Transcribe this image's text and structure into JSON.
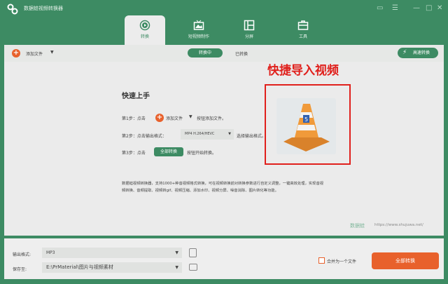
{
  "app": {
    "title": "数据蛙视频转换器"
  },
  "tabs": [
    {
      "label": "转换",
      "icon": "convert-icon",
      "active": true
    },
    {
      "label": "短视频制作",
      "icon": "tv-icon"
    },
    {
      "label": "分屏",
      "icon": "split-screen-icon"
    },
    {
      "label": "工具",
      "icon": "toolbox-icon"
    }
  ],
  "toolbar": {
    "add_file": "添加文件",
    "converting": "转换中",
    "converted": "已转换",
    "fast_convert": "高速转换"
  },
  "guide": {
    "title": "快速上手",
    "step1_prefix": "第1步：点击",
    "step1_button": "添加文件",
    "step1_suffix": "按钮添加文件。",
    "step2_prefix": "第2步：点击输出格式：",
    "step2_format": "MP4 H.264/HEVC",
    "step2_suffix": "选择输出格式。",
    "step3_prefix": "第3步：点击",
    "step3_button": "全部转换",
    "step3_suffix": "按钮开始转换。",
    "description": "数据蛙视频转换器，支持1000+种音视频格式转换，可在视频转换前对转换参数进行自定义调整，一键高效处理，实现音视频转换、音频提取、视频转gif、视频压缩、添加水印、视频分屏、噪音消除、图片转化等功能。"
  },
  "annotation": {
    "text": "快捷导入视频",
    "color": "#e0201c"
  },
  "watermark": {
    "brand": "数据蛙",
    "url": "https://www.shujuwa.net/"
  },
  "bottom": {
    "format_label": "输出格式:",
    "format_value": "MP3",
    "save_label": "保存至:",
    "save_value": "E:\\PrMaterial\\图片与视频素材",
    "merge_label": "合并为一个文件",
    "merge_checked": false,
    "convert_all": "全部转换"
  },
  "colors": {
    "brand": "#3d8b63",
    "accent": "#e8612c"
  }
}
